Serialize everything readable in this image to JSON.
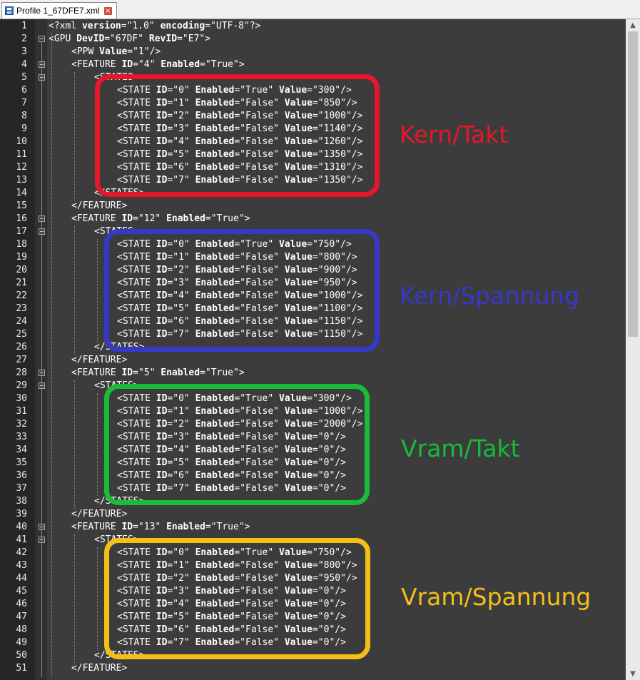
{
  "tab": {
    "title": "Profile 1_67DFE7.xml",
    "close": "×"
  },
  "colors": {
    "red": "#e5172a",
    "blue": "#3838c8",
    "green": "#18bc39",
    "yellow": "#f5bf1a"
  },
  "lines": [
    {
      "n": "1",
      "ind": 0,
      "fold": false,
      "t": "<?xml version=\"1.0\" encoding=\"UTF-8\"?>"
    },
    {
      "n": "2",
      "ind": 0,
      "fold": true,
      "t": "<GPU DevID=\"67DF\" RevID=\"E7\">"
    },
    {
      "n": "3",
      "ind": 1,
      "fold": false,
      "t": "<PPW Value=\"1\"/>"
    },
    {
      "n": "4",
      "ind": 1,
      "fold": true,
      "t": "<FEATURE ID=\"4\" Enabled=\"True\">"
    },
    {
      "n": "5",
      "ind": 2,
      "fold": true,
      "t": "<STATES>"
    },
    {
      "n": "6",
      "ind": 3,
      "fold": false,
      "t": "<STATE ID=\"0\" Enabled=\"True\" Value=\"300\"/>"
    },
    {
      "n": "7",
      "ind": 3,
      "fold": false,
      "t": "<STATE ID=\"1\" Enabled=\"False\" Value=\"850\"/>"
    },
    {
      "n": "8",
      "ind": 3,
      "fold": false,
      "t": "<STATE ID=\"2\" Enabled=\"False\" Value=\"1000\"/>"
    },
    {
      "n": "9",
      "ind": 3,
      "fold": false,
      "t": "<STATE ID=\"3\" Enabled=\"False\" Value=\"1140\"/>"
    },
    {
      "n": "10",
      "ind": 3,
      "fold": false,
      "t": "<STATE ID=\"4\" Enabled=\"False\" Value=\"1260\"/>"
    },
    {
      "n": "11",
      "ind": 3,
      "fold": false,
      "t": "<STATE ID=\"5\" Enabled=\"False\" Value=\"1350\"/>"
    },
    {
      "n": "12",
      "ind": 3,
      "fold": false,
      "t": "<STATE ID=\"6\" Enabled=\"False\" Value=\"1310\"/>"
    },
    {
      "n": "13",
      "ind": 3,
      "fold": false,
      "t": "<STATE ID=\"7\" Enabled=\"False\" Value=\"1350\"/>"
    },
    {
      "n": "14",
      "ind": 2,
      "fold": false,
      "t": "</STATES>"
    },
    {
      "n": "15",
      "ind": 1,
      "fold": false,
      "t": "</FEATURE>"
    },
    {
      "n": "16",
      "ind": 1,
      "fold": true,
      "t": "<FEATURE ID=\"12\" Enabled=\"True\">"
    },
    {
      "n": "17",
      "ind": 2,
      "fold": true,
      "t": "<STATES>"
    },
    {
      "n": "18",
      "ind": 3,
      "fold": false,
      "t": "<STATE ID=\"0\" Enabled=\"True\" Value=\"750\"/>"
    },
    {
      "n": "19",
      "ind": 3,
      "fold": false,
      "t": "<STATE ID=\"1\" Enabled=\"False\" Value=\"800\"/>"
    },
    {
      "n": "20",
      "ind": 3,
      "fold": false,
      "t": "<STATE ID=\"2\" Enabled=\"False\" Value=\"900\"/>"
    },
    {
      "n": "21",
      "ind": 3,
      "fold": false,
      "t": "<STATE ID=\"3\" Enabled=\"False\" Value=\"950\"/>"
    },
    {
      "n": "22",
      "ind": 3,
      "fold": false,
      "t": "<STATE ID=\"4\" Enabled=\"False\" Value=\"1000\"/>"
    },
    {
      "n": "23",
      "ind": 3,
      "fold": false,
      "t": "<STATE ID=\"5\" Enabled=\"False\" Value=\"1100\"/>"
    },
    {
      "n": "24",
      "ind": 3,
      "fold": false,
      "t": "<STATE ID=\"6\" Enabled=\"False\" Value=\"1150\"/>"
    },
    {
      "n": "25",
      "ind": 3,
      "fold": false,
      "t": "<STATE ID=\"7\" Enabled=\"False\" Value=\"1150\"/>"
    },
    {
      "n": "26",
      "ind": 2,
      "fold": false,
      "t": "</STATES>"
    },
    {
      "n": "27",
      "ind": 1,
      "fold": false,
      "t": "</FEATURE>"
    },
    {
      "n": "28",
      "ind": 1,
      "fold": true,
      "t": "<FEATURE ID=\"5\" Enabled=\"True\">"
    },
    {
      "n": "29",
      "ind": 2,
      "fold": true,
      "t": "<STATES>"
    },
    {
      "n": "30",
      "ind": 3,
      "fold": false,
      "t": "<STATE ID=\"0\" Enabled=\"True\" Value=\"300\"/>"
    },
    {
      "n": "31",
      "ind": 3,
      "fold": false,
      "t": "<STATE ID=\"1\" Enabled=\"False\" Value=\"1000\"/>"
    },
    {
      "n": "32",
      "ind": 3,
      "fold": false,
      "t": "<STATE ID=\"2\" Enabled=\"False\" Value=\"2000\"/>"
    },
    {
      "n": "33",
      "ind": 3,
      "fold": false,
      "t": "<STATE ID=\"3\" Enabled=\"False\" Value=\"0\"/>"
    },
    {
      "n": "34",
      "ind": 3,
      "fold": false,
      "t": "<STATE ID=\"4\" Enabled=\"False\" Value=\"0\"/>"
    },
    {
      "n": "35",
      "ind": 3,
      "fold": false,
      "t": "<STATE ID=\"5\" Enabled=\"False\" Value=\"0\"/>"
    },
    {
      "n": "36",
      "ind": 3,
      "fold": false,
      "t": "<STATE ID=\"6\" Enabled=\"False\" Value=\"0\"/>"
    },
    {
      "n": "37",
      "ind": 3,
      "fold": false,
      "t": "<STATE ID=\"7\" Enabled=\"False\" Value=\"0\"/>"
    },
    {
      "n": "38",
      "ind": 2,
      "fold": false,
      "t": "</STATES>"
    },
    {
      "n": "39",
      "ind": 1,
      "fold": false,
      "t": "</FEATURE>"
    },
    {
      "n": "40",
      "ind": 1,
      "fold": true,
      "t": "<FEATURE ID=\"13\" Enabled=\"True\">"
    },
    {
      "n": "41",
      "ind": 2,
      "fold": true,
      "t": "<STATES>"
    },
    {
      "n": "42",
      "ind": 3,
      "fold": false,
      "t": "<STATE ID=\"0\" Enabled=\"True\" Value=\"750\"/>"
    },
    {
      "n": "43",
      "ind": 3,
      "fold": false,
      "t": "<STATE ID=\"1\" Enabled=\"False\" Value=\"800\"/>"
    },
    {
      "n": "44",
      "ind": 3,
      "fold": false,
      "t": "<STATE ID=\"2\" Enabled=\"False\" Value=\"950\"/>"
    },
    {
      "n": "45",
      "ind": 3,
      "fold": false,
      "t": "<STATE ID=\"3\" Enabled=\"False\" Value=\"0\"/>"
    },
    {
      "n": "46",
      "ind": 3,
      "fold": false,
      "t": "<STATE ID=\"4\" Enabled=\"False\" Value=\"0\"/>"
    },
    {
      "n": "47",
      "ind": 3,
      "fold": false,
      "t": "<STATE ID=\"5\" Enabled=\"False\" Value=\"0\"/>"
    },
    {
      "n": "48",
      "ind": 3,
      "fold": false,
      "t": "<STATE ID=\"6\" Enabled=\"False\" Value=\"0\"/>"
    },
    {
      "n": "49",
      "ind": 3,
      "fold": false,
      "t": "<STATE ID=\"7\" Enabled=\"False\" Value=\"0\"/>"
    },
    {
      "n": "50",
      "ind": 2,
      "fold": false,
      "t": "</STATES>"
    },
    {
      "n": "51",
      "ind": 1,
      "fold": false,
      "t": "</FEATURE>"
    }
  ],
  "annotations": [
    {
      "label": "Kern/Takt",
      "color": "red"
    },
    {
      "label": "Kern/Spannung",
      "color": "blue"
    },
    {
      "label": "Vram/Takt",
      "color": "green"
    },
    {
      "label": "Vram/Spannung",
      "color": "yellow"
    }
  ]
}
